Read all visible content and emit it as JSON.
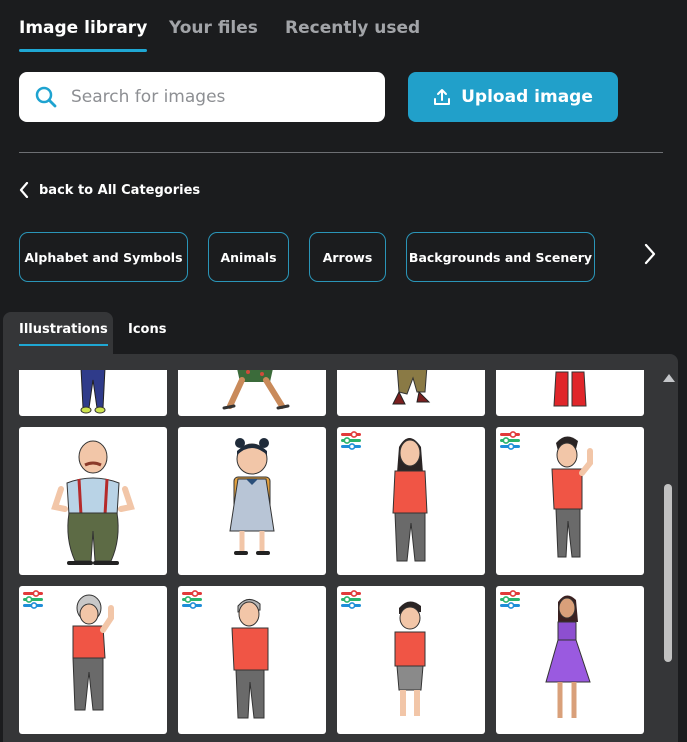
{
  "tabs": [
    {
      "label": "Image library",
      "active": true
    },
    {
      "label": "Your files",
      "active": false
    },
    {
      "label": "Recently used",
      "active": false
    }
  ],
  "search": {
    "placeholder": "Search for images",
    "value": "",
    "icon": "search-icon"
  },
  "upload": {
    "label": "Upload image",
    "icon": "upload-icon"
  },
  "back": {
    "label": "back to All Categories",
    "icon": "chevron-left-icon"
  },
  "categories": [
    {
      "label": "Alphabet and Symbols"
    },
    {
      "label": "Animals"
    },
    {
      "label": "Arrows"
    },
    {
      "label": "Backgrounds and Scenery"
    }
  ],
  "category_next_icon": "chevron-right-icon",
  "subtabs": [
    {
      "label": "Illustrations",
      "active": true
    },
    {
      "label": "Icons",
      "active": false
    }
  ],
  "images": [
    {
      "subject": "person legs blue pants",
      "customizable": false
    },
    {
      "subject": "person legs walking green skirt",
      "customizable": false
    },
    {
      "subject": "person legs khaki pants",
      "customizable": false
    },
    {
      "subject": "person legs red boots",
      "customizable": false
    },
    {
      "subject": "bald man with mustache and suspenders",
      "customizable": false
    },
    {
      "subject": "girl with backpack",
      "customizable": false
    },
    {
      "subject": "woman in red shirt",
      "customizable": true
    },
    {
      "subject": "young man waving",
      "customizable": true
    },
    {
      "subject": "elderly woman waving",
      "customizable": true
    },
    {
      "subject": "elderly man",
      "customizable": true
    },
    {
      "subject": "boy in shorts",
      "customizable": true
    },
    {
      "subject": "woman in purple dress",
      "customizable": true
    }
  ],
  "colors": {
    "background": "#1b1c1e",
    "panel": "#353638",
    "accent": "#1fa7d3",
    "upload_button": "#21a0ca",
    "inactive_tab": "#a2a4a8"
  }
}
